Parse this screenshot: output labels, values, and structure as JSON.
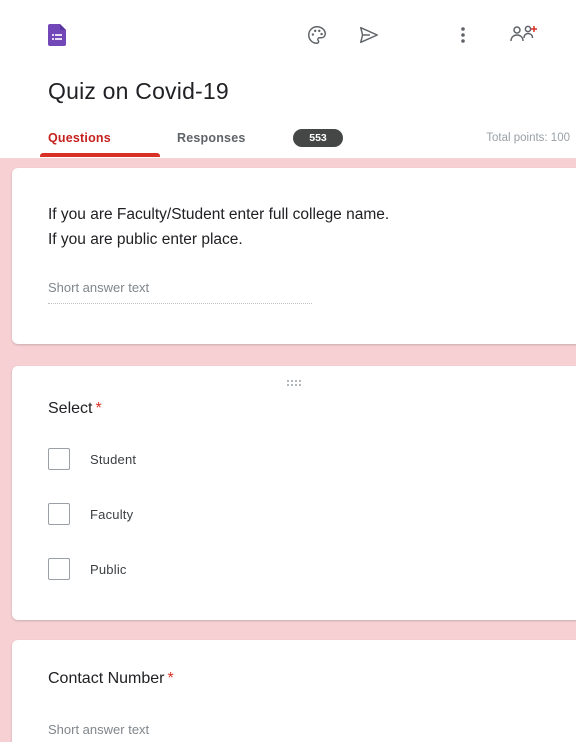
{
  "header": {
    "icons": [
      "forms-app-icon",
      "palette-icon",
      "send-icon",
      "more-vert-icon",
      "add-collaborator-icon"
    ]
  },
  "form": {
    "title": "Quiz on Covid-19"
  },
  "tabs": {
    "questions": "Questions",
    "responses": "Responses",
    "responses_count": "553",
    "total_points": "Total points: 100"
  },
  "questions": [
    {
      "text_line1": "If you are Faculty/Student enter full college name.",
      "text_line2": "If you are public enter place.",
      "placeholder": "Short answer text"
    },
    {
      "title": "Select",
      "required_mark": "*",
      "options": [
        "Student",
        "Faculty",
        "Public"
      ]
    },
    {
      "title": "Contact Number",
      "required_mark": "*",
      "placeholder": "Short answer text"
    }
  ],
  "colors": {
    "accent": "#d93025",
    "band": "#f6d0d3",
    "app_icon": "#7248b9"
  }
}
